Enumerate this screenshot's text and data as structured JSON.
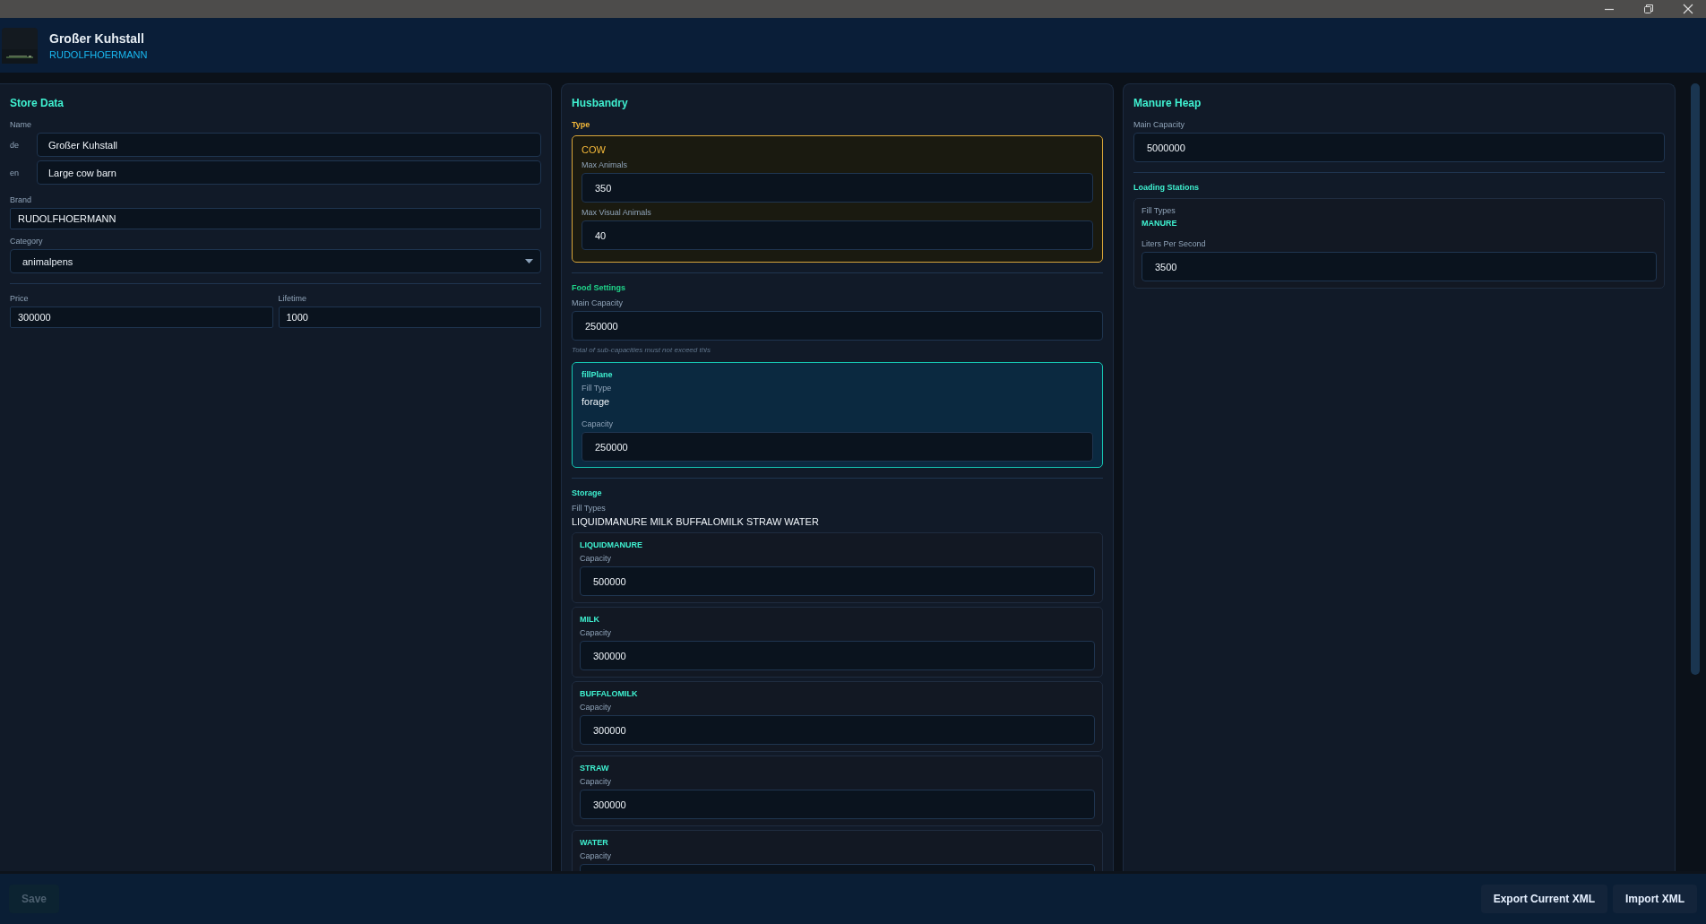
{
  "header": {
    "title": "Großer Kuhstall",
    "subtitle": "RUDOLFHOERMANN"
  },
  "store_data": {
    "title": "Store Data",
    "name_label": "Name",
    "names": [
      {
        "lang": "de",
        "value": "Großer Kuhstall"
      },
      {
        "lang": "en",
        "value": "Large cow barn"
      }
    ],
    "brand": {
      "label": "Brand",
      "value": "RUDOLFHOERMANN"
    },
    "category": {
      "label": "Category",
      "value": "animalpens"
    },
    "price": {
      "label": "Price",
      "value": "300000"
    },
    "lifetime": {
      "label": "Lifetime",
      "value": "1000"
    }
  },
  "husbandry": {
    "title": "Husbandry",
    "type_label": "Type",
    "animal": {
      "name": "COW",
      "fields": [
        {
          "label": "Max Animals",
          "value": "350"
        },
        {
          "label": "Max Visual Animals",
          "value": "40"
        }
      ]
    },
    "food": {
      "title": "Food Settings",
      "main_capacity": {
        "label": "Main Capacity",
        "value": "250000"
      },
      "hint": "Total of sub-capacities must not exceed this",
      "fill_plane": {
        "name": "fillPlane",
        "fill_type_label": "Fill Type",
        "fill_type": "forage",
        "capacity": {
          "label": "Capacity",
          "value": "250000"
        }
      }
    },
    "storage": {
      "title": "Storage",
      "fill_types_label": "Fill Types",
      "fill_types": "LIQUIDMANURE MILK BUFFALOMILK STRAW WATER",
      "items": [
        {
          "name": "LIQUIDMANURE",
          "label": "Capacity",
          "value": "500000"
        },
        {
          "name": "MILK",
          "label": "Capacity",
          "value": "300000"
        },
        {
          "name": "BUFFALOMILK",
          "label": "Capacity",
          "value": "300000"
        },
        {
          "name": "STRAW",
          "label": "Capacity",
          "value": "300000"
        },
        {
          "name": "WATER",
          "label": "Capacity"
        }
      ]
    }
  },
  "manure_heap": {
    "title": "Manure Heap",
    "main_capacity": {
      "label": "Main Capacity",
      "value": "5000000"
    },
    "loading_stations": {
      "title": "Loading Stations",
      "stations": [
        {
          "fill_types_label": "Fill Types",
          "fill_types": "MANURE",
          "rate": {
            "label": "Liters Per Second",
            "value": "3500"
          }
        }
      ]
    }
  },
  "footer": {
    "save": {
      "label": "Save",
      "disabled": true
    },
    "buttons": [
      "Export Current XML",
      "Import XML"
    ]
  }
}
